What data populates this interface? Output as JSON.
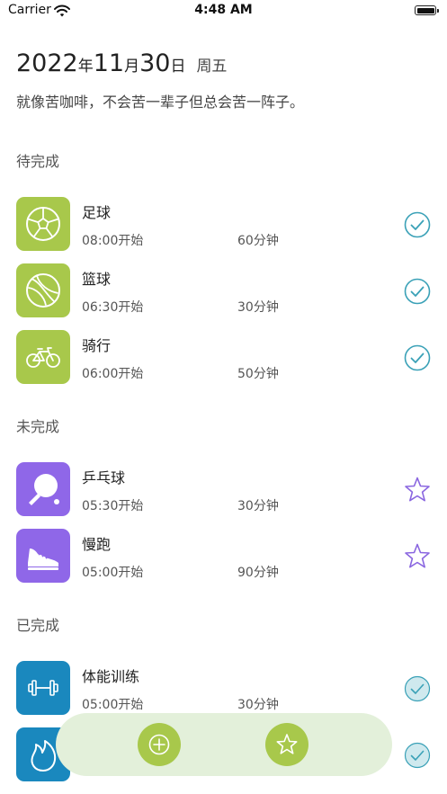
{
  "status_bar": {
    "carrier": "Carrier",
    "time": "4:48 AM",
    "icons": [
      "wifi-icon",
      "battery-icon"
    ]
  },
  "header": {
    "year": "2022",
    "year_unit": "年",
    "month": "11",
    "month_unit": "月",
    "day": "30",
    "day_unit": "日",
    "weekday": "周五",
    "quote": "就像苦咖啡，不会苦一辈子但总会苦一阵子。"
  },
  "sections": {
    "pending": {
      "title": "待完成",
      "items": [
        {
          "name": "足球",
          "start": "08:00开始",
          "duration": "60分钟",
          "icon": "soccer-ball-icon",
          "action_icon": "check-circle-icon"
        },
        {
          "name": "篮球",
          "start": "06:30开始",
          "duration": "30分钟",
          "icon": "ball-icon",
          "action_icon": "check-circle-icon"
        },
        {
          "name": "骑行",
          "start": "06:00开始",
          "duration": "50分钟",
          "icon": "bicycle-icon",
          "action_icon": "check-circle-icon"
        }
      ]
    },
    "unfinished": {
      "title": "未完成",
      "items": [
        {
          "name": "乒乓球",
          "start": "05:30开始",
          "duration": "30分钟",
          "icon": "ping-pong-icon",
          "action_icon": "star-outline-icon"
        },
        {
          "name": "慢跑",
          "start": "05:00开始",
          "duration": "90分钟",
          "icon": "running-shoe-icon",
          "action_icon": "star-outline-icon"
        }
      ]
    },
    "completed": {
      "title": "已完成",
      "items": [
        {
          "name": "体能训练",
          "start": "05:00开始",
          "duration": "30分钟",
          "icon": "dumbbell-icon",
          "action_icon": "check-circle-filled-icon"
        },
        {
          "icon": "flame-icon",
          "action_icon": "check-circle-filled-icon"
        }
      ]
    }
  },
  "toolbar": {
    "buttons": [
      "add-circle-icon",
      "star-icon"
    ]
  },
  "colors": {
    "tile_green": "#a8c84b",
    "tile_purple": "#8f67e8",
    "tile_blue": "#1a88be",
    "check_teal": "#3aa1b7",
    "star_purple": "#8a66e0",
    "completed_fill": "#cfe9ee",
    "toolbar_bg": "#e3f0da",
    "fab_green": "#a8c84b"
  }
}
